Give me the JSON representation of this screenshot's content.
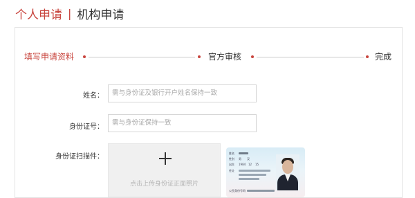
{
  "header": {
    "tab_personal": "个人申请",
    "separator": "|",
    "tab_org": "机构申请"
  },
  "steps": [
    {
      "label": "填写申请资料",
      "state": "active"
    },
    {
      "label": "官方审核",
      "state": "todo"
    },
    {
      "label": "完成",
      "state": "todo"
    }
  ],
  "form": {
    "name_label": "姓名：",
    "name_placeholder": "需与身份证及银行开户姓名保持一致",
    "id_label": "身份证号：",
    "id_placeholder": "需与身份证保持一致",
    "scan_label": "身份证扫描件：",
    "upload_hint": "点击上传身份证正面照片"
  },
  "sample_id_card": {
    "fields": [
      "姓名",
      "性别",
      "出生",
      "住址",
      "公民身份号码"
    ],
    "fragments": [
      "男",
      "汉",
      "1984",
      "12",
      "15"
    ]
  },
  "colors": {
    "accent": "#c8453e",
    "line": "#c9c9c9",
    "border": "#e3e3e3",
    "upload_bg": "#f0f0f0"
  },
  "icons": {
    "upload": "plus-icon"
  }
}
